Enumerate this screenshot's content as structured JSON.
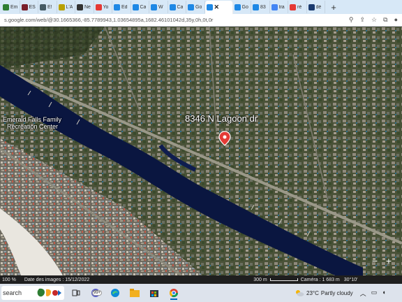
{
  "browser": {
    "tabs": [
      {
        "label": "Em",
        "color": "#2e7d32"
      },
      {
        "label": "ES",
        "color": "#7a1f2b"
      },
      {
        "label": "E!",
        "color": "#455a64"
      },
      {
        "label": "L'A",
        "color": "#b8a000"
      },
      {
        "label": "Ne",
        "color": "#333333"
      },
      {
        "label": "Yo",
        "color": "#e53935"
      },
      {
        "label": "Ed",
        "color": "#1e88e5"
      },
      {
        "label": "Ca",
        "color": "#1e88e5"
      },
      {
        "label": "W",
        "color": "#1e88e5"
      },
      {
        "label": "Ca",
        "color": "#1e88e5"
      },
      {
        "label": "Go",
        "color": "#1e88e5"
      },
      {
        "label": "",
        "color": "#1e88e5",
        "active": true
      },
      {
        "label": "Go",
        "color": "#1e88e5"
      },
      {
        "label": "83",
        "color": "#1e88e5"
      },
      {
        "label": "tra",
        "color": "#4285f4"
      },
      {
        "label": "ré",
        "color": "#e53935"
      },
      {
        "label": "dé",
        "color": "#1a3a6e"
      }
    ],
    "close_glyph": "✕",
    "new_tab_glyph": "+",
    "url": "s.google.com/web/@30.1665366,-85.7789943,1.03654895a,1682.46101042d,35y,0h,0t,0r"
  },
  "map": {
    "address_label": "8346 N Lagoon dr",
    "place_label_line1": "Emerald Falls Family",
    "place_label_line2": "Recreation Center",
    "zoom_out": "−",
    "zoom_in": "+"
  },
  "status": {
    "zoom_pct": "100 %",
    "imagery_date": "Date des images : 15/12/2022",
    "scale_label": "300 m",
    "camera": "Caméra : 1 683 m",
    "coords": "30°10'"
  },
  "taskbar": {
    "search_text": "search",
    "badge_count": "99+",
    "temperature": "23°C",
    "weather_text": "Partly cloudy"
  }
}
